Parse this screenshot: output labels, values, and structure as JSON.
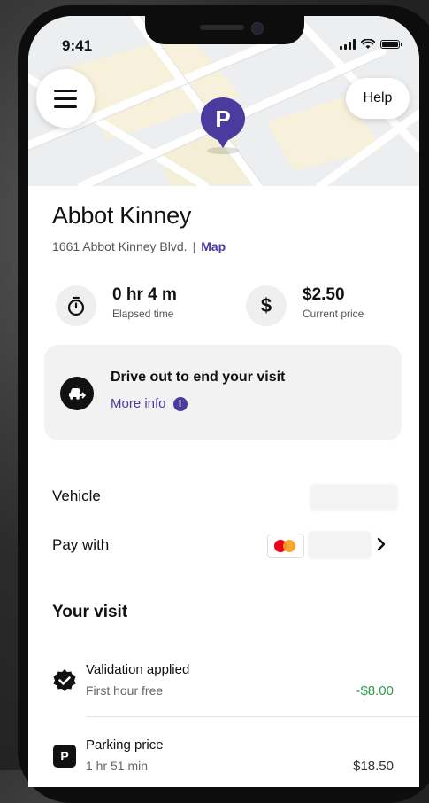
{
  "status_bar": {
    "time": "9:41"
  },
  "header": {
    "help_label": "Help",
    "pin_letter": "P"
  },
  "location": {
    "name": "Abbot Kinney",
    "address": "1661 Abbot Kinney Blvd.",
    "separator": "|",
    "map_link": "Map"
  },
  "stats": [
    {
      "value": "0 hr 4 m",
      "label": "Elapsed time",
      "icon": "stopwatch-icon"
    },
    {
      "value": "$2.50",
      "label": "Current price",
      "icon": "dollar-icon"
    }
  ],
  "banner": {
    "title": "Drive out to end your visit",
    "link": "More info",
    "info_glyph": "i",
    "icon": "car-exit-icon"
  },
  "details": {
    "vehicle_label": "Vehicle",
    "pay_with_label": "Pay with",
    "card_icon": "mastercard-icon"
  },
  "visit": {
    "title": "Your visit",
    "items": [
      {
        "title": "Validation applied",
        "subtitle": "First hour free",
        "amount": "-$8.00",
        "icon": "verified-badge-icon",
        "amount_color": "#2e9b4a"
      },
      {
        "title": "Parking price",
        "subtitle": "1 hr 51 min",
        "amount": "$18.50",
        "icon": "parking-icon",
        "badge": "P",
        "amount_color": "#333333"
      }
    ]
  },
  "colors": {
    "brand": "#4b3b9f",
    "credit": "#2e9b4a"
  }
}
